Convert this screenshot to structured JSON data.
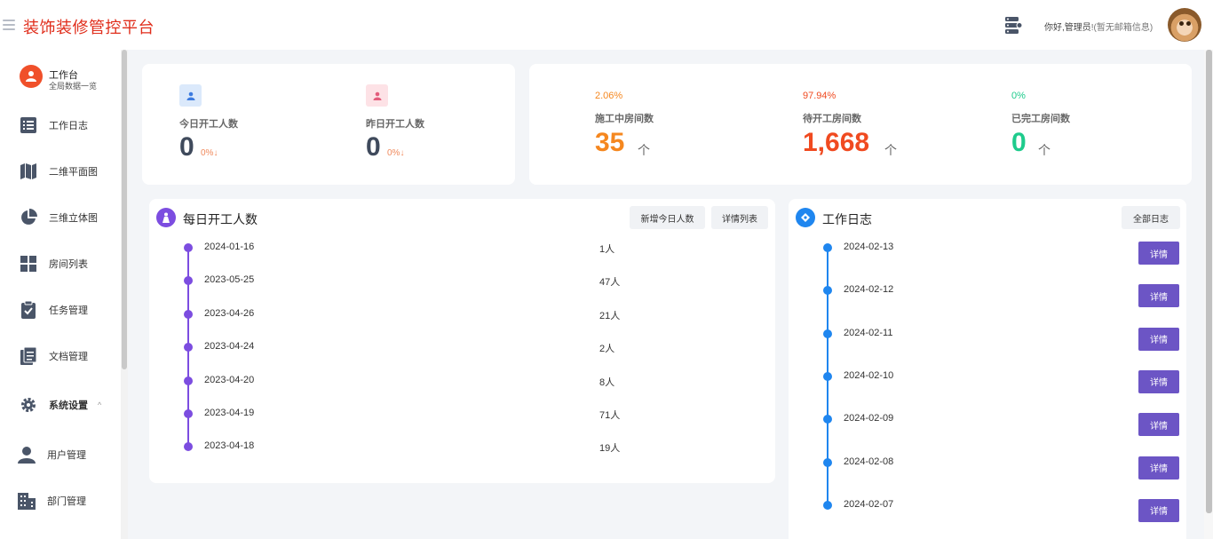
{
  "header": {
    "title": "装饰装修管控平台",
    "greeting": "你好,管理员",
    "greeting_sub": "!(暂无邮箱信息)"
  },
  "sidebar": {
    "items": [
      {
        "label": "工作台",
        "sub": "全局数据一览",
        "icon": "workbench-icon"
      },
      {
        "label": "工作日志",
        "icon": "work-log-icon"
      },
      {
        "label": "二维平面图",
        "icon": "map-icon"
      },
      {
        "label": "三维立体图",
        "icon": "pie-chart-icon"
      },
      {
        "label": "房间列表",
        "icon": "grid-icon"
      },
      {
        "label": "任务管理",
        "icon": "clipboard-icon"
      },
      {
        "label": "文档管理",
        "icon": "document-icon"
      },
      {
        "label": "系统设置",
        "icon": "gear-icon",
        "caret": "^"
      },
      {
        "label": "用户管理",
        "icon": "user-icon"
      },
      {
        "label": "部门管理",
        "icon": "building-icon"
      }
    ]
  },
  "workers": {
    "today_label": "今日开工人数",
    "today_value": "0",
    "today_pct": "0%↓",
    "yesterday_label": "昨日开工人数",
    "yesterday_value": "0",
    "yesterday_pct": "0%↓"
  },
  "rooms": {
    "in_progress": {
      "pct": "2.06%",
      "label": "施工中房间数",
      "value": "35",
      "unit": "个",
      "color": "#f5871f"
    },
    "pending": {
      "pct": "97.94%",
      "label": "待开工房间数",
      "value": "1,668",
      "unit": "个",
      "color": "#f04a20"
    },
    "completed": {
      "pct": "0%",
      "label": "已完工房间数",
      "value": "0",
      "unit": "个",
      "color": "#1ecb8c"
    }
  },
  "daily": {
    "title": "每日开工人数",
    "add_button": "新增今日人数",
    "list_button": "详情列表",
    "rows": [
      {
        "date": "2024-01-16",
        "count": "1人"
      },
      {
        "date": "2023-05-25",
        "count": "47人"
      },
      {
        "date": "2023-04-26",
        "count": "21人"
      },
      {
        "date": "2023-04-24",
        "count": "2人"
      },
      {
        "date": "2023-04-20",
        "count": "8人"
      },
      {
        "date": "2023-04-19",
        "count": "71人"
      },
      {
        "date": "2023-04-18",
        "count": "19人"
      }
    ]
  },
  "worklog": {
    "title": "工作日志",
    "all_button": "全部日志",
    "detail_label": "详情",
    "dates": [
      "2024-02-13",
      "2024-02-12",
      "2024-02-11",
      "2024-02-10",
      "2024-02-09",
      "2024-02-08",
      "2024-02-07"
    ]
  }
}
